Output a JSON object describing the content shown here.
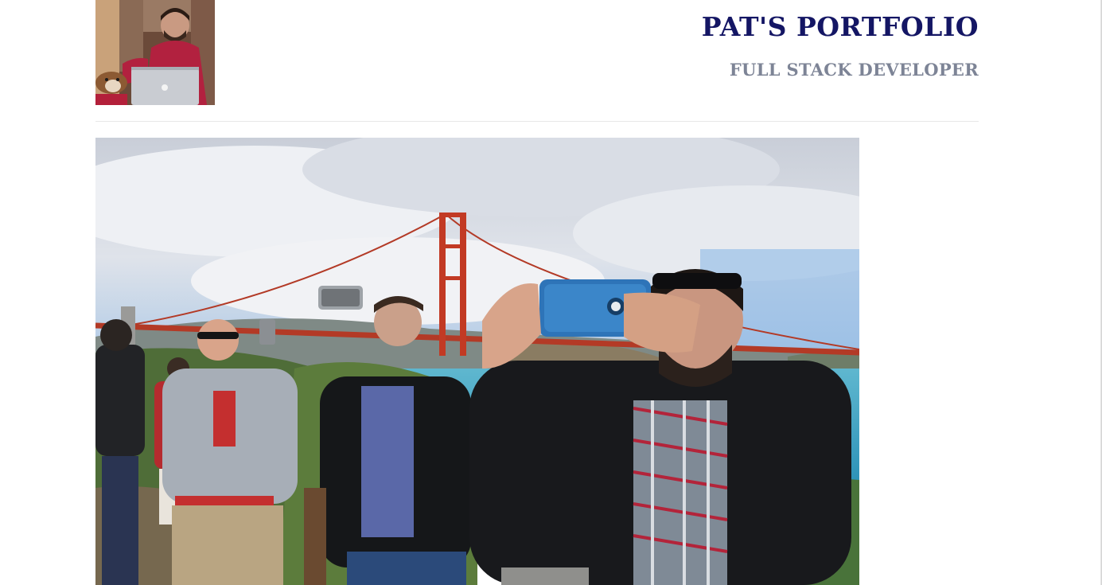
{
  "header": {
    "title": "PAT'S PORTFOLIO",
    "subtitle": "FULL STACK DEVELOPER"
  },
  "colors": {
    "title": "#141664",
    "subtitle": "#7d8496",
    "background": "#ffffff",
    "divider": "#e8e8e8"
  }
}
